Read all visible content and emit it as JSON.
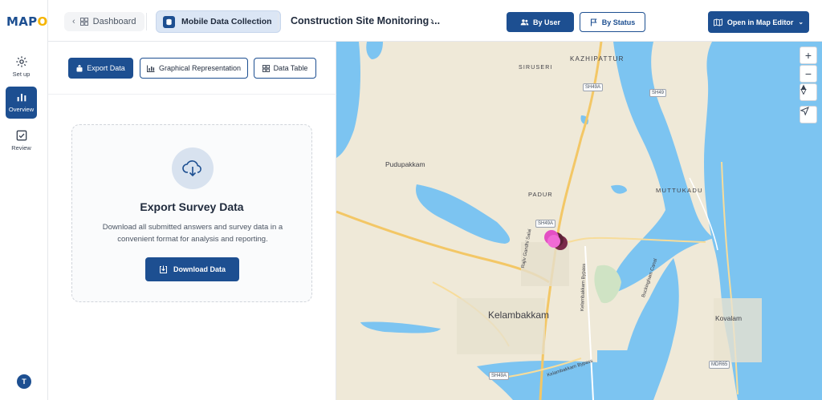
{
  "app": {
    "logo_prefix": "MAP",
    "logo_accent": "OG"
  },
  "rail": {
    "items": [
      {
        "label": "Set up",
        "icon": "gear-icon"
      },
      {
        "label": "Overview",
        "icon": "bar-chart-icon"
      },
      {
        "label": "Review",
        "icon": "checkbox-icon"
      }
    ],
    "avatar_initial": "T"
  },
  "header": {
    "back_label": "Dashboard",
    "section_label": "Mobile Data Collection",
    "project_title": "Construction Site Monitoring ...",
    "by_user_label": "By User",
    "by_status_label": "By Status",
    "open_editor_label": "Open in Map Editor"
  },
  "tabs": [
    {
      "label": "Export Data",
      "active": true
    },
    {
      "label": "Graphical Representation",
      "active": false
    },
    {
      "label": "Data Table",
      "active": false
    }
  ],
  "export_card": {
    "title": "Export Survey Data",
    "description": "Download all submitted answers and survey data in a convenient format for analysis and reporting.",
    "button_label": "Download Data"
  },
  "map": {
    "controls": [
      "zoom-in",
      "zoom-out",
      "compass",
      "locate"
    ],
    "places": [
      "KAZHIPATTUR",
      "SIRUSERI",
      "Pudupakkam",
      "PADUR",
      "MUTTUKADU",
      "Kelambakkam",
      "Kovalam"
    ],
    "road_labels": [
      "SH49A",
      "SH49",
      "SH49A",
      "SH49A",
      "MDR65",
      "Rajiv Gandhi Salai",
      "Kelambakkam Bypass",
      "Kelambakkam Bypass",
      "Buckingham Canal"
    ],
    "colors": {
      "land": "#efe9d8",
      "water": "#7cc4f1",
      "road_major": "#f3c766",
      "marker": "#e34fc3",
      "marker_dark": "#7a2a4a"
    }
  }
}
